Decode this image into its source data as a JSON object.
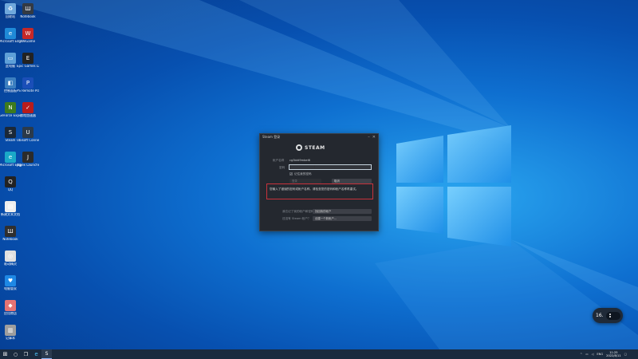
{
  "desktop": {
    "icons": [
      {
        "label": "回收站",
        "glyph": "♻",
        "color": "#6fa8dc"
      },
      {
        "label": "Notebook",
        "glyph": "Ш",
        "color": "#333a44"
      },
      {
        "label": "Microsoft Edge",
        "glyph": "e",
        "color": "#1f8ad8"
      },
      {
        "label": "WeGame",
        "glyph": "W",
        "color": "#c62828"
      },
      {
        "label": "此电脑",
        "glyph": "▭",
        "color": "#5ea0d8"
      },
      {
        "label": "Epic Games Launcher",
        "glyph": "E",
        "color": "#222"
      },
      {
        "label": "控制面板",
        "glyph": "◧",
        "color": "#3c7fc0"
      },
      {
        "label": "PS Remote Play",
        "glyph": "P",
        "color": "#1b4fb8"
      },
      {
        "label": "GeForce Experience",
        "glyph": "N",
        "color": "#3d7a1e"
      },
      {
        "label": "游戏加速器",
        "glyph": "✓",
        "color": "#b71c1c"
      },
      {
        "label": "Steam",
        "glyph": "S",
        "color": "#1b2838"
      },
      {
        "label": "Ubisoft Connect",
        "glyph": "U",
        "color": "#2b3a4a"
      },
      {
        "label": "Microsoft Edge",
        "glyph": "e",
        "color": "#1aa8c8"
      },
      {
        "label": "Jagex Launcher",
        "glyph": "J",
        "color": "#2b2b2b"
      },
      {
        "label": "QQ",
        "glyph": "Q",
        "color": "#222"
      },
      {
        "label": "新建文本文档",
        "glyph": "▤",
        "color": "#eeeeee"
      },
      {
        "label": "Notebook",
        "glyph": "Ш",
        "color": "#2f2f2f"
      },
      {
        "label": "驱动精灵",
        "glyph": "◎",
        "color": "#e0e0e0"
      },
      {
        "label": "电脑管家",
        "glyph": "♥",
        "color": "#1e88e5"
      },
      {
        "label": "应用商店",
        "glyph": "◆",
        "color": "#e57373"
      },
      {
        "label": "记事本",
        "glyph": "▥",
        "color": "#9e9e9e"
      }
    ]
  },
  "dialog": {
    "title": "Steam 登录",
    "minimize": "–",
    "close": "✕",
    "brand": "STEAM",
    "account_label": "帐户名称",
    "account_value": "cg3bkt9mbei6",
    "password_label": "密码",
    "password_value": "",
    "remember_label": "记住我的密码",
    "remember_checked": "✓",
    "login_button": "登录",
    "cancel_button": "取消",
    "error_text": "您输入了错误的密码或帐户名称。请检查您的密码和帐户名称再重试。",
    "forgot_label": "我忘记了我的帐户和密码？",
    "forgot_button": "找回我的帐户",
    "no_account_label": "还没有 Steam 帐户？",
    "create_button": "创建一个新帐户..."
  },
  "widget": {
    "value": "16."
  },
  "taskbar": {
    "start": "⊞",
    "search": "○",
    "taskview": "❐",
    "edge": "e",
    "explorer": "▬",
    "steam": "S",
    "ime": "ENG",
    "time": "11:25",
    "date": "2022/8/11"
  }
}
